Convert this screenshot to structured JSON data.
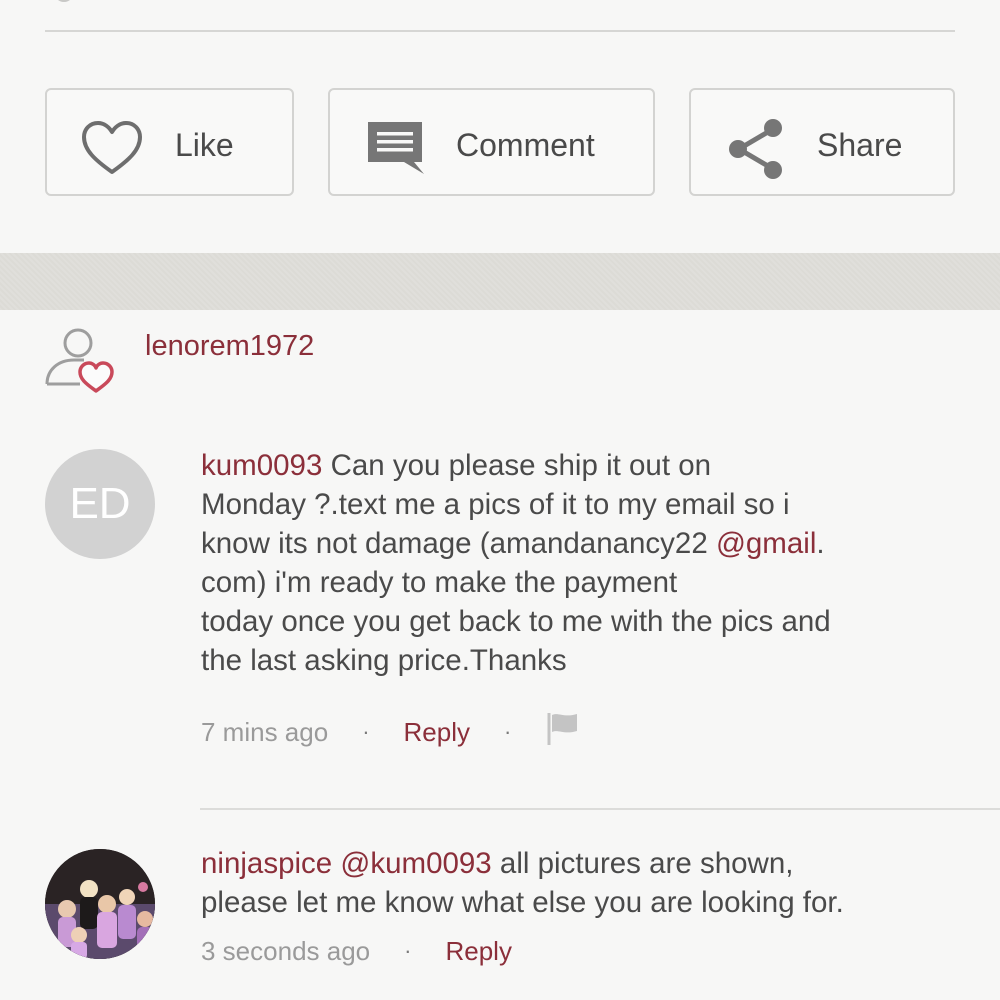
{
  "actions": {
    "like_label": "Like",
    "comment_label": "Comment",
    "share_label": "Share"
  },
  "post": {
    "username": "lenorem1972"
  },
  "comments": [
    {
      "avatar_initials": "ED",
      "author": "kum0093",
      "text_line1": "Can you please ship it out on",
      "text_line2": "Monday ?.text me a pics of it to my email so i",
      "text_line3_a": "know its not damage (amandanancy22 ",
      "text_line3_link": "@gmail",
      "text_line3_b": ".",
      "text_line4": "com) i'm ready to make the payment",
      "text_line5": "today once you get back to me with the pics and",
      "text_line6": "the last asking price.Thanks",
      "time": "7 mins ago",
      "reply_label": "Reply",
      "separator": "·"
    },
    {
      "author": "ninjaspice",
      "mention": "@kum0093",
      "text_line1": "all pictures are shown,",
      "text_line2": "please let me know what else you are looking for.",
      "time": "3 seconds ago",
      "reply_label": "Reply",
      "separator": "·"
    }
  ],
  "colors": {
    "accent": "#8b2f3a",
    "text": "#4a4a4a",
    "muted": "#9a9a9a",
    "avatar_bg": "#d2d2d2"
  },
  "icons": [
    "heart-icon",
    "comment-icon",
    "share-icon",
    "user-heart-icon",
    "flag-icon"
  ]
}
